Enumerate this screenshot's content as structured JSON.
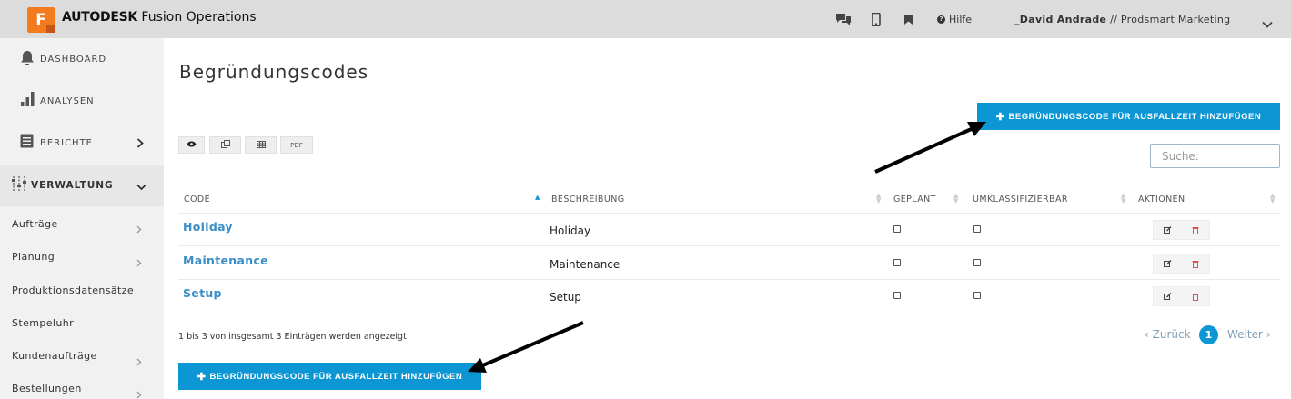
{
  "header": {
    "logo_letter": "F",
    "brand_bold": "AUTODESK",
    "brand_rest": "Fusion Operations",
    "help_label": "Hilfe",
    "user_name": "_David Andrade",
    "user_org": "// Prodsmart Marketing",
    "icons": [
      "chat-icon",
      "mobile-icon",
      "bookmark-icon",
      "help-icon",
      "chevron-down-icon"
    ]
  },
  "sidebar": {
    "main_items": [
      {
        "label": "DASHBOARD",
        "icon": "bell-icon"
      },
      {
        "label": "ANALYSEN",
        "icon": "bar-chart-icon"
      },
      {
        "label": "BERICHTE",
        "icon": "report-icon"
      },
      {
        "label": "VERWALTUNG",
        "icon": "sliders-icon"
      }
    ],
    "sub_items": [
      {
        "label": "Aufträge"
      },
      {
        "label": "Planung"
      },
      {
        "label": "Produktionsdatensätze"
      },
      {
        "label": "Stempeluhr"
      },
      {
        "label": "Kundenaufträge"
      },
      {
        "label": "Bestellungen"
      }
    ]
  },
  "main": {
    "title": "Begründungscodes",
    "add_button_label": "BEGRÜNDUNGSCODE FÜR AUSFALLZEIT HINZUFÜGEN",
    "add_button_icon": "plus-icon",
    "toolbar": {
      "pdf_label": "PDF",
      "icons": [
        "eye-icon",
        "copy-icon",
        "csv-icon"
      ]
    },
    "search": {
      "placeholder": "Suche:",
      "value": ""
    },
    "table": {
      "columns": [
        "CODE",
        "BESCHREIBUNG",
        "GEPLANT",
        "UMKLASSIFIZIERBAR",
        "AKTIONEN"
      ],
      "rows": [
        {
          "code": "Holiday",
          "description": "Holiday",
          "geplant": false,
          "umklassifizierbar": false
        },
        {
          "code": "Maintenance",
          "description": "Maintenance",
          "geplant": false,
          "umklassifizierbar": false
        },
        {
          "code": "Setup",
          "description": "Setup",
          "geplant": false,
          "umklassifizierbar": false
        }
      ],
      "row_action_icons": [
        "edit-icon",
        "delete-icon"
      ]
    },
    "info_text": "1 bis 3 von insgesamt 3 Einträgen werden angezeigt",
    "pagination": {
      "prev": "Zurück",
      "current": "1",
      "next": "Weiter"
    }
  },
  "colors": {
    "primary": "#0d96d4",
    "link": "#3a8fc8",
    "topbar": "#dcdcdc",
    "sidebar": "#f1f1f1",
    "logo": "#f47a20",
    "delete": "#e05050"
  }
}
